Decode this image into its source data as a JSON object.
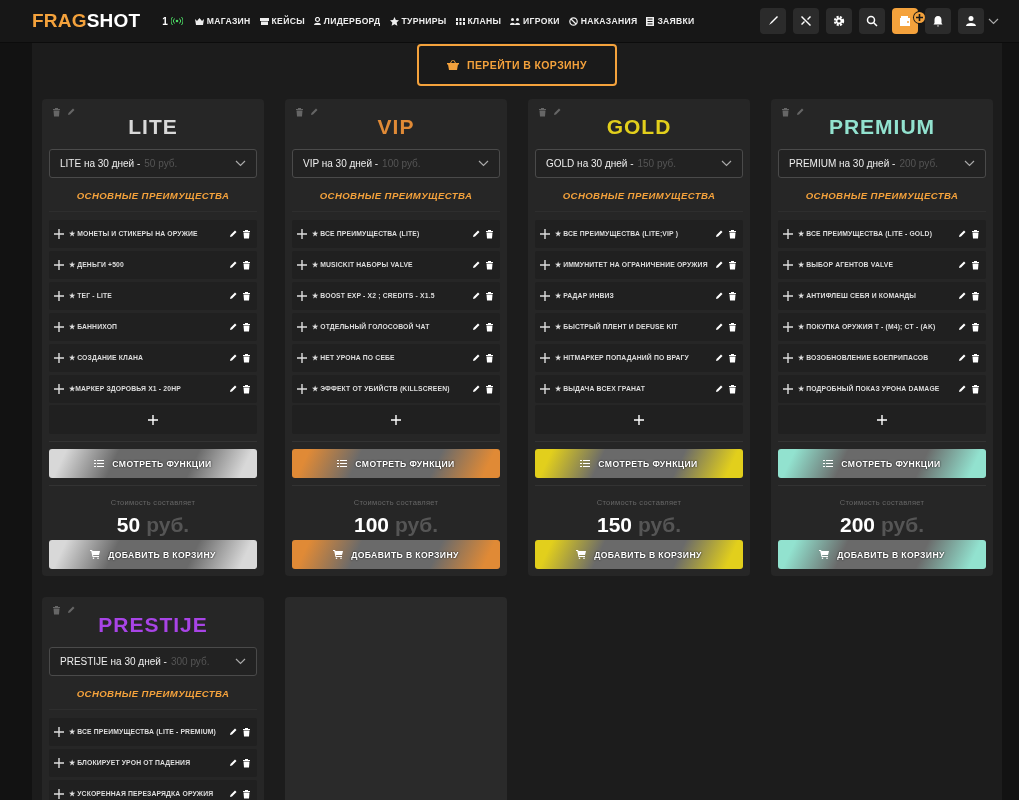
{
  "header": {
    "logo": {
      "accent": "FRAG",
      "rest": "SHOT"
    },
    "online_count": "1",
    "nav": [
      {
        "label": "МАГАЗИН"
      },
      {
        "label": "КЕЙСЫ"
      },
      {
        "label": "ЛИДЕРБОРД"
      },
      {
        "label": "ТУРНИРЫ"
      },
      {
        "label": "КЛАНЫ"
      },
      {
        "label": "ИГРОКИ"
      },
      {
        "label": "НАКАЗАНИЯ"
      },
      {
        "label": "ЗАЯВКИ"
      }
    ]
  },
  "cart_link": "ПЕРЕЙТИ В КОРЗИНУ",
  "tiers": [
    {
      "kind": "plan",
      "title": "LITE",
      "color": "#d8d8d8",
      "select_label": "LITE на 30 дней -",
      "select_price": "50 руб.",
      "section_heading": "ОСНОВНЫЕ ПРЕИМУЩЕСТВА",
      "features": [
        "★ МОНЕТЫ И СТИКЕРЫ НА ОРУЖИЕ",
        "★ ДЕНЬГИ +500",
        "★ ТЕГ - LITE",
        "★ БАННИХОП",
        "★ СОЗДАНИЕ КЛАНА",
        "★МАРКЕР ЗДОРОВЬЯ X1 - 20HP"
      ],
      "view_button": "СМОТРЕТЬ ФУНКЦИИ",
      "price_caption": "Стоимость составляет",
      "price": "50",
      "currency": "руб.",
      "cart_button": "ДОБАВИТЬ В КОРЗИНУ"
    },
    {
      "kind": "plan",
      "title": "VIP",
      "color": "#e08a36",
      "select_label": "VIP на 30 дней -",
      "select_price": "100 руб.",
      "section_heading": "ОСНОВНЫЕ ПРЕИМУЩЕСТВА",
      "features": [
        "★ ВСЕ ПРЕИМУЩЕСТВА (LITE)",
        "★ MUSICKIT НАБОРЫ VALVE",
        "★ BOOST EXP - X2 ; CREDITS - X1.5",
        "★ ОТДЕЛЬНЫЙ ГОЛОСОВОЙ ЧАТ",
        "★ НЕТ УРОНА ПО СЕБЕ",
        "★ ЭФФЕКТ ОТ УБИЙСТВ (KILLSCREEN)"
      ],
      "view_button": "СМОТРЕТЬ ФУНКЦИИ",
      "price_caption": "Стоимость составляет",
      "price": "100",
      "currency": "руб.",
      "cart_button": "ДОБАВИТЬ В КОРЗИНУ"
    },
    {
      "kind": "plan",
      "title": "GOLD",
      "color": "#e2cf1c",
      "select_label": "GOLD на 30 дней -",
      "select_price": "150 руб.",
      "section_heading": "ОСНОВНЫЕ ПРЕИМУЩЕСТВА",
      "features": [
        "★ ВСЕ ПРЕИМУЩЕСТВА (LITE;VIP )",
        "★ ИММУНИТЕТ НА ОГРАНИЧЕНИЕ ОРУЖИЯ",
        "★ РАДАР ИНВИЗ",
        "★ БЫСТРЫЙ ПЛЕНТ И DEFUSE KIT",
        "★ HITМАРКЕР ПОПАДАНИЙ ПО ВРАГУ",
        "★ ВЫДАЧА ВСЕХ ГРАНАТ"
      ],
      "view_button": "СМОТРЕТЬ ФУНКЦИИ",
      "price_caption": "Стоимость составляет",
      "price": "150",
      "currency": "руб.",
      "cart_button": "ДОБАВИТЬ В КОРЗИНУ"
    },
    {
      "kind": "plan",
      "title": "PREMIUM",
      "color": "#92e2cf",
      "select_label": "PREMIUM на 30 дней -",
      "select_price": "200 руб.",
      "section_heading": "ОСНОВНЫЕ ПРЕИМУЩЕСТВА",
      "features": [
        "★ ВСЕ ПРЕИМУЩЕСТВА (LITE - GOLD)",
        "★ ВЫБОР АГЕНТОВ VALVE",
        "★ АНТИФЛЕШ СЕБЯ И КОМАНДЫ",
        "★ ПОКУПКА ОРУЖИЯ Т - (M4); CT - (AK)",
        "★ ВОЗОБНОВЛЕНИЕ БОЕПРИПАСОВ",
        "★ ПОДРОБНЫЙ ПОКАЗ УРОНА DAMAGE"
      ],
      "view_button": "СМОТРЕТЬ ФУНКЦИИ",
      "price_caption": "Стоимость составляет",
      "price": "200",
      "currency": "руб.",
      "cart_button": "ДОБАВИТЬ В КОРЗИНУ"
    },
    {
      "kind": "plan",
      "title": "PRESTIJE",
      "color": "#a844e6",
      "select_label": "PRESTIJE на 30 дней -",
      "select_price": "300 руб.",
      "section_heading": "ОСНОВНЫЕ ПРЕИМУЩЕСТВА",
      "features": [
        "★ ВСЕ ПРЕИМУЩЕСТВА (LITE - PREMIUM)",
        "★ БЛОКИРУЕТ УРОН ОТ ПАДЕНИЯ",
        "★ УСКОРЕННАЯ ПЕРЕЗАРЯДКА ОРУЖИЯ"
      ]
    },
    {
      "kind": "empty"
    }
  ]
}
